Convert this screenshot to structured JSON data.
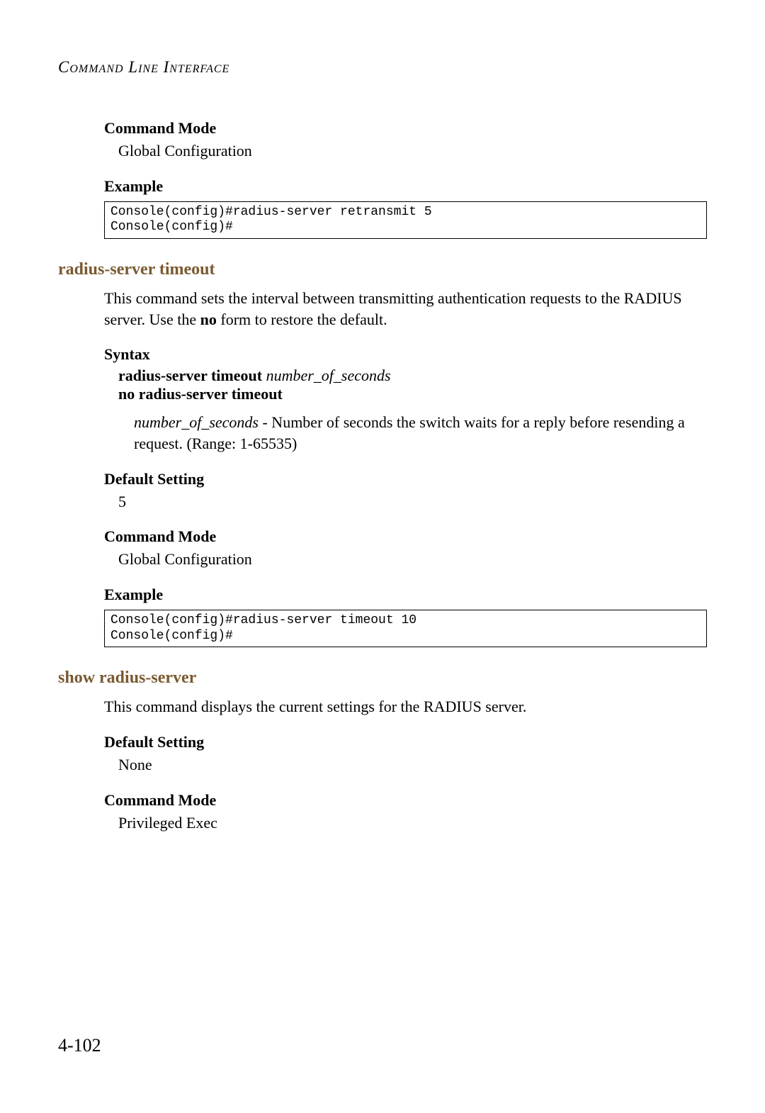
{
  "running_head": "Command Line Interface",
  "section1": {
    "cmdmode_label": "Command Mode",
    "cmdmode_value": "Global Configuration",
    "example_label": "Example",
    "code": "Console(config)#radius-server retransmit 5\nConsole(config)#"
  },
  "section2": {
    "heading": "radius-server timeout",
    "desc_part1": "This command sets the interval between transmitting authentication requests to the RADIUS server. Use the ",
    "desc_bold": "no",
    "desc_part2": " form to restore the default.",
    "syntax_label": "Syntax",
    "syntax_cmd_bold": "radius-server timeout",
    "syntax_cmd_ital": "number_of_seconds",
    "syntax_no": "no radius-server timeout",
    "param_ital": "number_of_seconds",
    "param_desc": " - Number of seconds the switch waits for a reply before resending a request. (Range: 1-65535)",
    "default_label": "Default Setting",
    "default_value": "5",
    "cmdmode_label": "Command Mode",
    "cmdmode_value": "Global Configuration",
    "example_label": "Example",
    "code": "Console(config)#radius-server timeout 10\nConsole(config)#"
  },
  "section3": {
    "heading": "show radius-server",
    "desc": "This command displays the current settings for the RADIUS server.",
    "default_label": "Default Setting",
    "default_value": "None",
    "cmdmode_label": "Command Mode",
    "cmdmode_value": "Privileged Exec"
  },
  "page_number": "4-102"
}
